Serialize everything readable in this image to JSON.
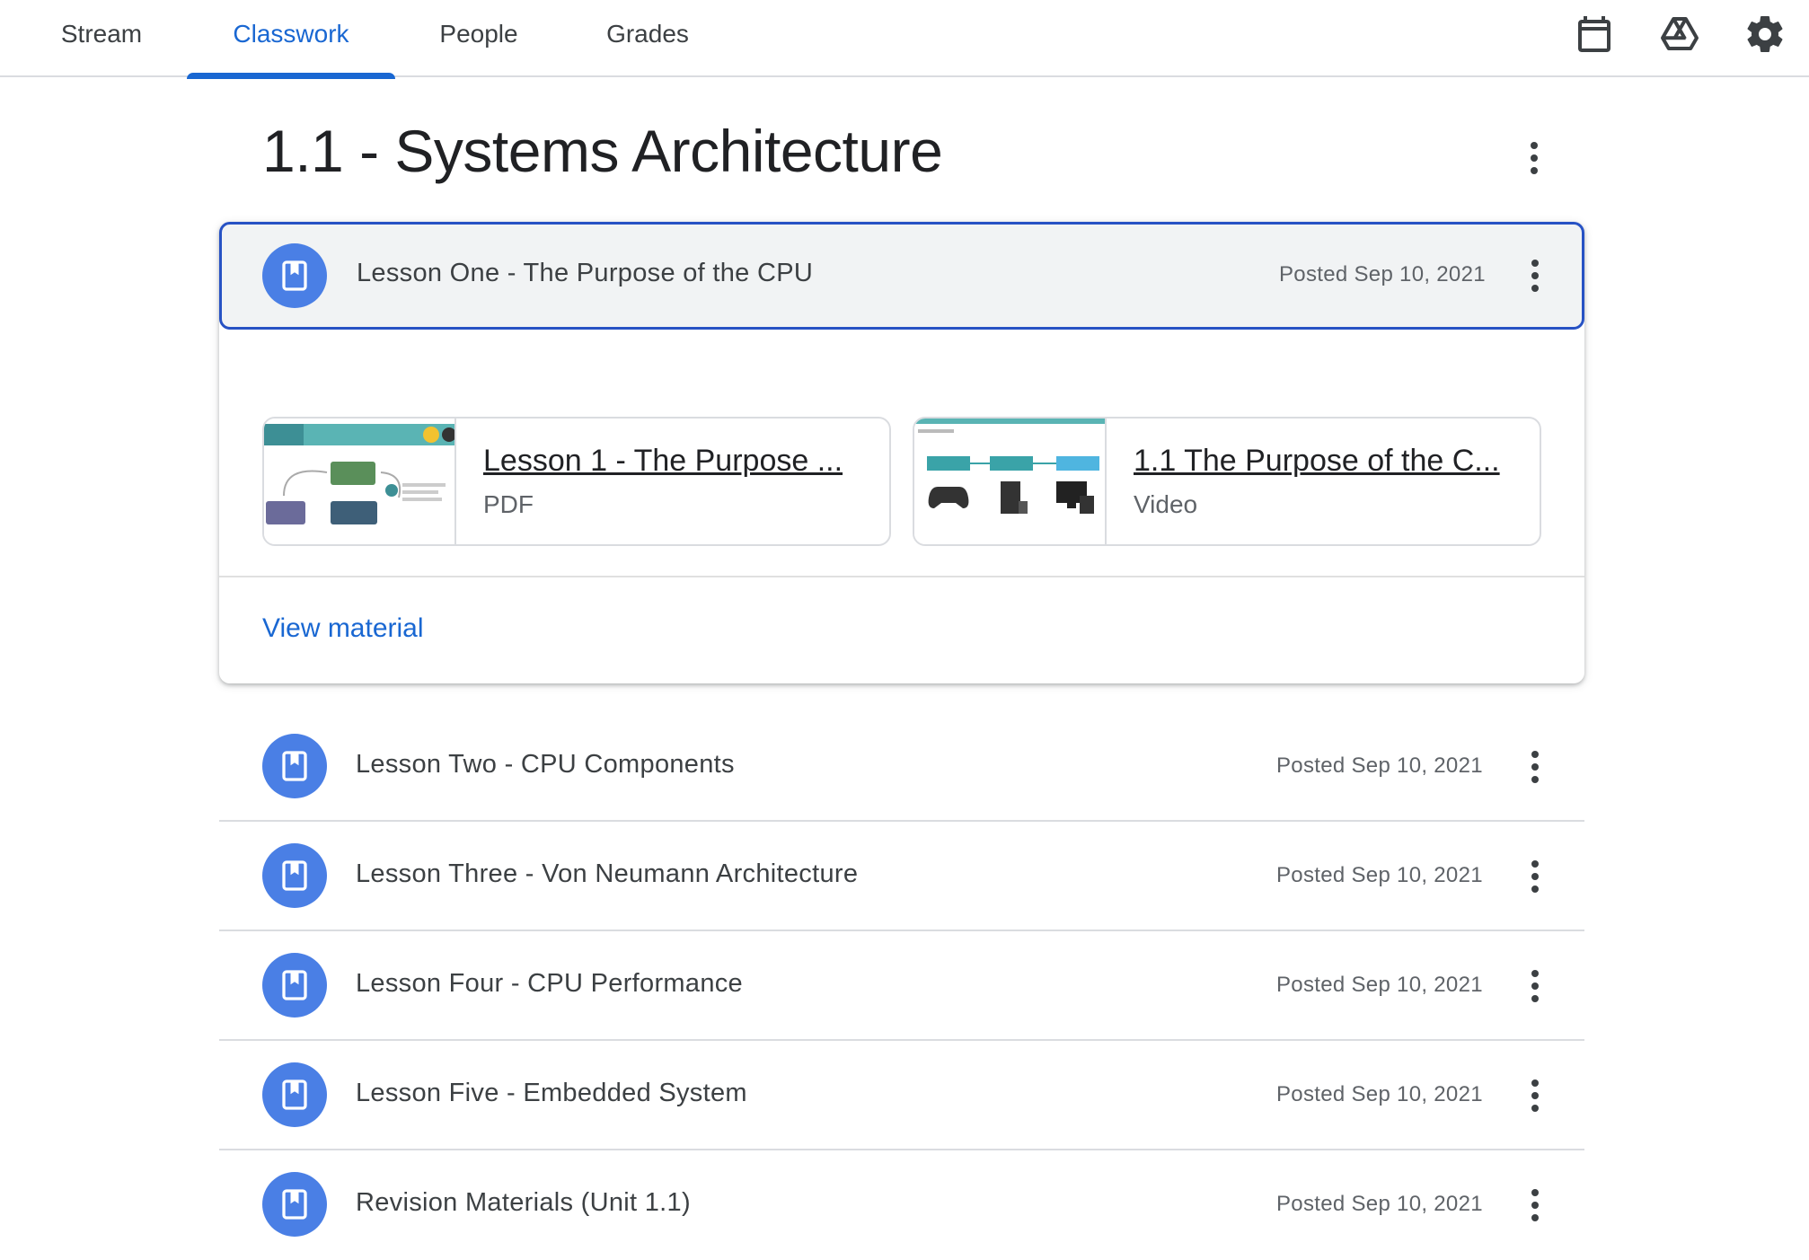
{
  "nav": {
    "tabs": [
      {
        "label": "Stream"
      },
      {
        "label": "Classwork"
      },
      {
        "label": "People"
      },
      {
        "label": "Grades"
      }
    ],
    "active_tab": "Classwork",
    "icons": [
      "calendar-icon",
      "google-drive-icon",
      "settings-gear-icon"
    ],
    "accent_color": "#1967d2"
  },
  "topic": {
    "title": "1.1 - Systems Architecture"
  },
  "expanded": {
    "title": "Lesson One - The Purpose of the CPU",
    "posted": "Posted Sep 10, 2021",
    "attachments": [
      {
        "title": "Lesson 1 - The Purpose ...",
        "type": "PDF"
      },
      {
        "title": "1.1 The Purpose of the C...",
        "type": "Video"
      }
    ],
    "view_label": "View material"
  },
  "materials": [
    {
      "title": "Lesson Two - CPU Components",
      "posted": "Posted Sep 10, 2021"
    },
    {
      "title": "Lesson Three - Von Neumann Architecture",
      "posted": "Posted Sep 10, 2021"
    },
    {
      "title": "Lesson Four - CPU Performance",
      "posted": "Posted Sep 10, 2021"
    },
    {
      "title": "Lesson Five - Embedded System",
      "posted": "Posted Sep 10, 2021"
    },
    {
      "title": "Revision Materials (Unit 1.1)",
      "posted": "Posted Sep 10, 2021"
    }
  ]
}
